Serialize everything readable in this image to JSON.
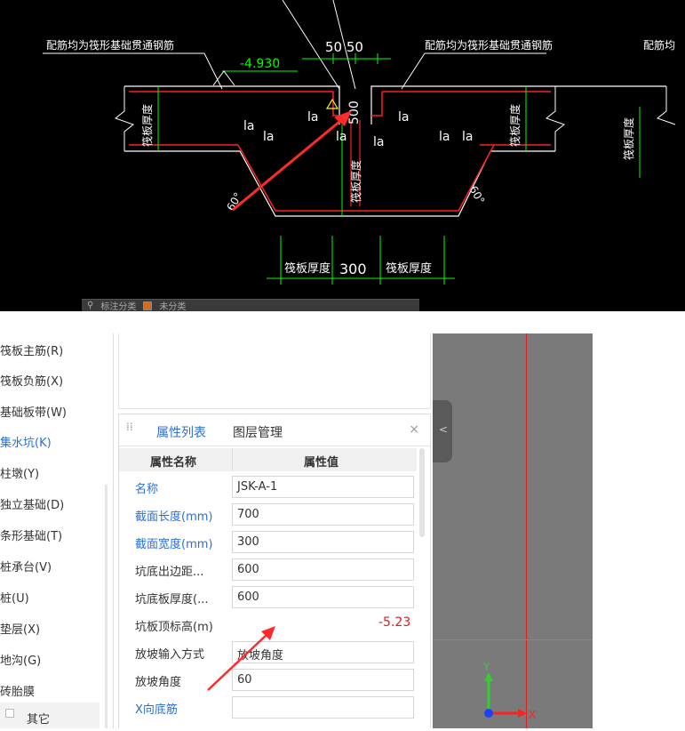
{
  "cad": {
    "note_left": "配筋均为筏形基础贯通钢筋",
    "note_right": "配筋均为筏形基础贯通钢筋",
    "note_far_right": "配筋均",
    "elevation": "-4.930",
    "dim_top": "50 50",
    "dim_500": "500",
    "dim_bottom": "300",
    "raft_thickness": "筏板厚度",
    "la": "la",
    "angle": "60°"
  },
  "cad_toolbar": {
    "item1": "标注分类",
    "item2": "未分类"
  },
  "tree": {
    "items": [
      {
        "label": "筏板主筋(R)",
        "active": false
      },
      {
        "label": "筏板负筋(X)",
        "active": false
      },
      {
        "label": "基础板带(W)",
        "active": false
      },
      {
        "label": "集水坑(K)",
        "active": true
      },
      {
        "label": "柱墩(Y)",
        "active": false
      },
      {
        "label": "独立基础(D)",
        "active": false
      },
      {
        "label": "条形基础(T)",
        "active": false
      },
      {
        "label": "桩承台(V)",
        "active": false
      },
      {
        "label": "桩(U)",
        "active": false
      },
      {
        "label": "垫层(X)",
        "active": false
      },
      {
        "label": "地沟(G)",
        "active": false
      },
      {
        "label": "砖胎膜",
        "active": false
      }
    ],
    "footer_label": "其它"
  },
  "panel": {
    "tab_properties": "属性列表",
    "tab_layers": "图层管理",
    "close": "×",
    "col_name": "属性名称",
    "col_value": "属性值"
  },
  "properties": [
    {
      "name": "名称",
      "value": "JSK-A-1",
      "blue": true
    },
    {
      "name": "截面长度(mm)",
      "value": "700",
      "blue": true
    },
    {
      "name": "截面宽度(mm)",
      "value": "300",
      "blue": true
    },
    {
      "name": "坑底出边距...",
      "value": "600",
      "blue": false
    },
    {
      "name": "坑底板厚度(...",
      "value": "600",
      "blue": false
    },
    {
      "name": "坑板顶标高(m)",
      "value": "",
      "blue": false
    },
    {
      "name": "放坡输入方式",
      "value": "放坡角度",
      "blue": false
    },
    {
      "name": "放坡角度",
      "value": "60",
      "blue": false
    },
    {
      "name": "X向底筋",
      "value": "",
      "blue": true
    }
  ],
  "annotation_value": "-5.23",
  "axis": {
    "y": "Y",
    "x": "X"
  },
  "colors": {
    "accent_blue": "#2b6fd6",
    "annotation_red": "#d81e1e",
    "cad_green": "#00ff00",
    "cad_red": "#ff0000"
  }
}
